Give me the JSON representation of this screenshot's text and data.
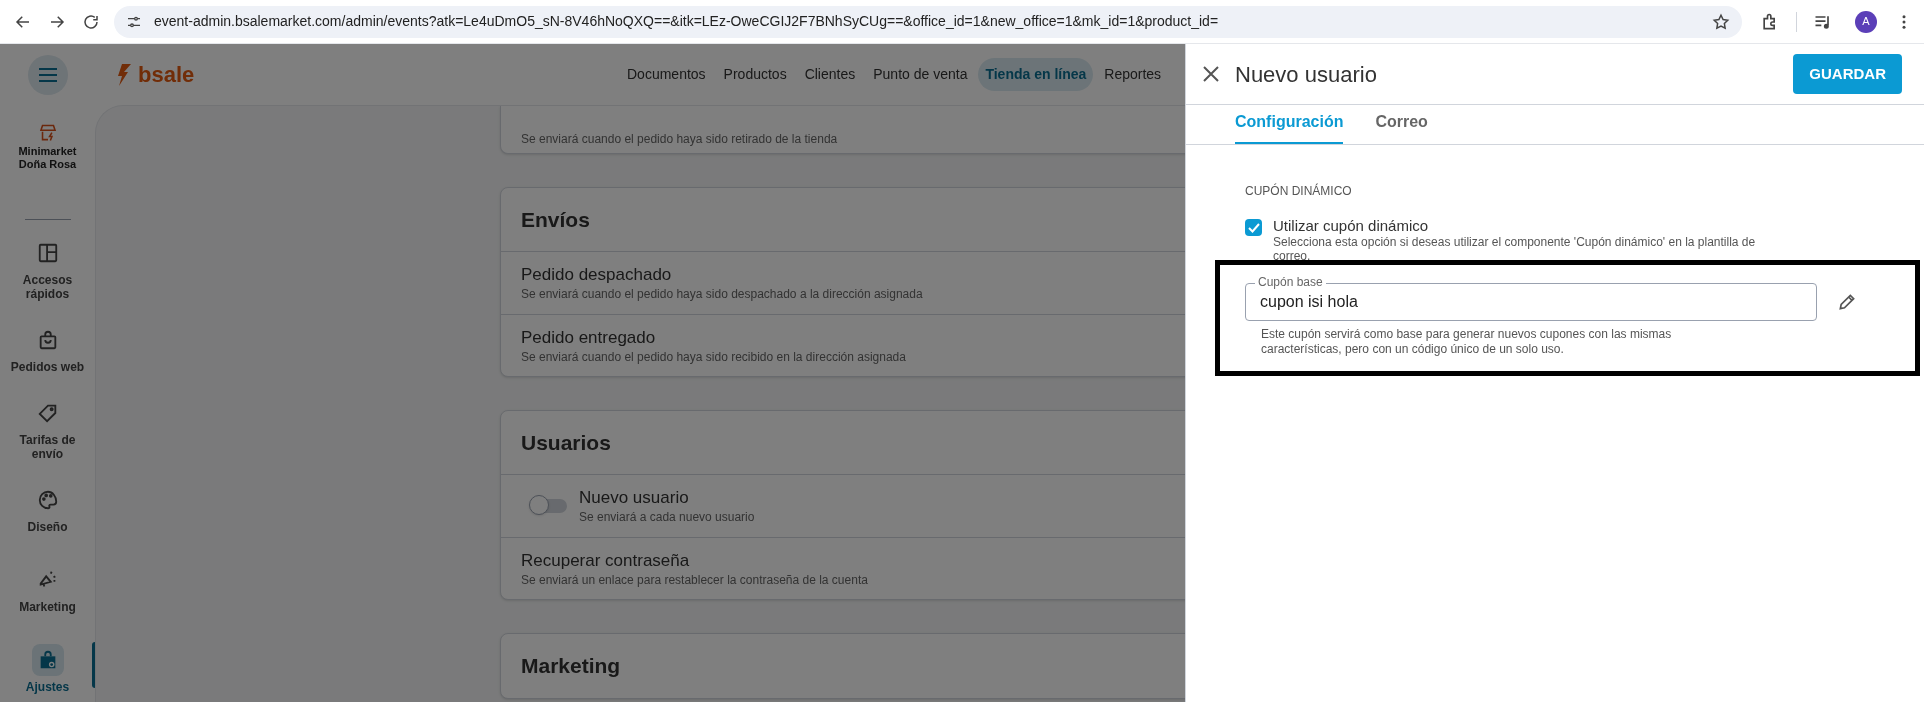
{
  "browser": {
    "url": "event-admin.bsalemarket.com/admin/events?atk=Le4uDmO5_sN-8V46hNoQXQ==&itk=LEz-OweCGIJ2F7BNhSyCUg==&office_id=1&new_office=1&mk_id=1&product_id=",
    "avatar_initial": "A"
  },
  "app": {
    "logo": "bsale",
    "nav": [
      {
        "label": "Documentos",
        "selected": false
      },
      {
        "label": "Productos",
        "selected": false
      },
      {
        "label": "Clientes",
        "selected": false
      },
      {
        "label": "Punto de venta",
        "selected": false
      },
      {
        "label": "Tienda en línea",
        "selected": true
      },
      {
        "label": "Reportes",
        "selected": false
      }
    ],
    "sidebar": {
      "store_name": "Minimarket Doña Rosa",
      "items": [
        {
          "label": "Accesos rápidos",
          "selected": false
        },
        {
          "label": "Pedidos web",
          "selected": false
        },
        {
          "label": "Tarifas de envío",
          "selected": false
        },
        {
          "label": "Diseño",
          "selected": false
        },
        {
          "label": "Marketing",
          "selected": false
        },
        {
          "label": "Ajustes",
          "selected": true
        }
      ]
    },
    "sections": [
      {
        "items": [
          {
            "kind": "plain",
            "description": "Se enviará cuando el pedido haya sido retirado de la tienda"
          }
        ]
      },
      {
        "title": "Envíos",
        "items": [
          {
            "kind": "plain",
            "title": "Pedido despachado",
            "description": "Se enviará cuando el pedido haya sido despachado a la dirección asignada"
          },
          {
            "kind": "plain",
            "title": "Pedido entregado",
            "description": "Se enviará cuando el pedido haya sido recibido en la dirección asignada"
          }
        ]
      },
      {
        "title": "Usuarios",
        "items": [
          {
            "kind": "toggle",
            "on": false,
            "title": "Nuevo usuario",
            "description": "Se enviará a cada nuevo usuario"
          },
          {
            "kind": "plain",
            "title": "Recuperar contraseña",
            "description": "Se enviará un enlace para restablecer la contraseña de la cuenta"
          }
        ]
      },
      {
        "title": "Marketing"
      }
    ]
  },
  "panel": {
    "title": "Nuevo usuario",
    "save_button": "GUARDAR",
    "tabs": [
      {
        "label": "Configuración",
        "selected": true
      },
      {
        "label": "Correo",
        "selected": false
      }
    ],
    "section_heading": "CUPÓN DINÁMICO",
    "checkbox": {
      "label": "Utilizar cupón dinámico",
      "description": "Selecciona esta opción si deseas utilizar el componente 'Cupón dinámico' en la plantilla de correo.",
      "checked": true
    },
    "field": {
      "label": "Cupón base",
      "value": "cupon isi hola"
    },
    "help": "Este cupón servirá como base para generar nuevos cupones con las mismas características, pero con un código único de un solo uso."
  }
}
